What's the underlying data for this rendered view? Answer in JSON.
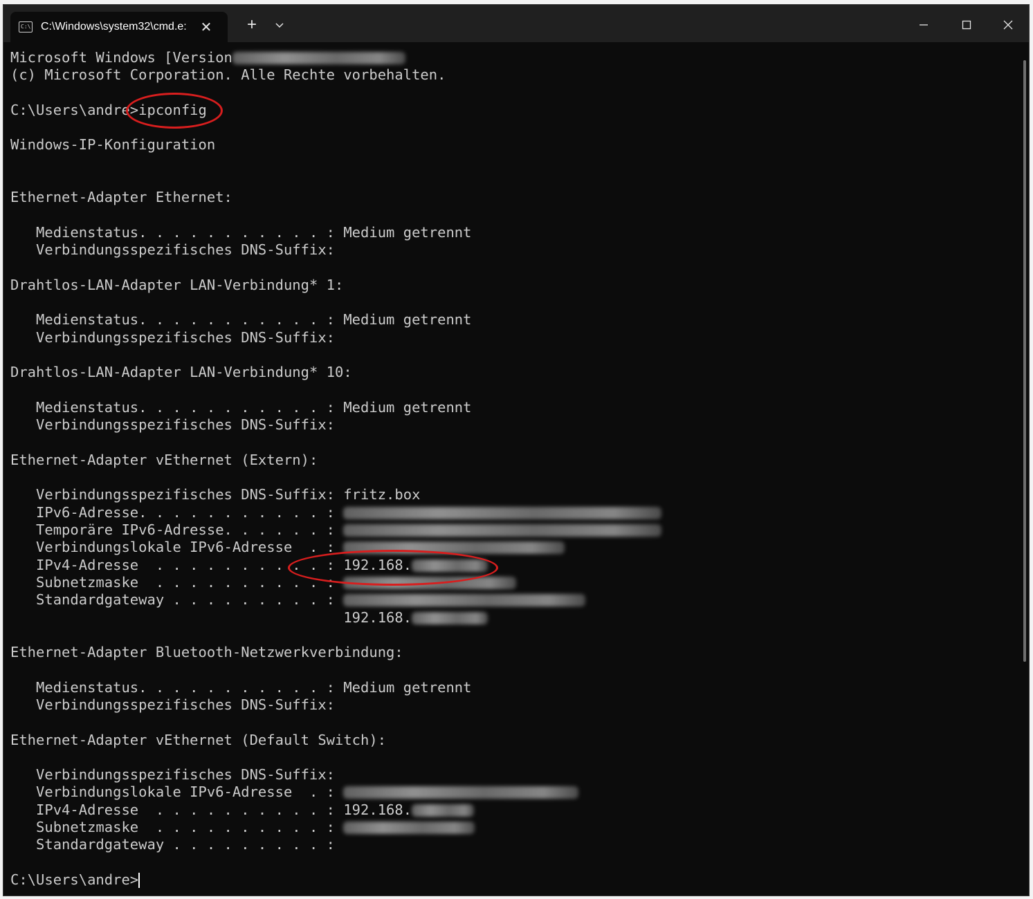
{
  "window": {
    "tab_title": "C:\\Windows\\system32\\cmd.e:",
    "tab_close_glyph": "✕",
    "new_tab_glyph": "+",
    "dropdown_glyph": "⌄",
    "min_glyph": "—",
    "max_glyph": "☐",
    "close_glyph": "✕"
  },
  "terminal": {
    "lines": [
      "Microsoft Windows [Version",
      "(c) Microsoft Corporation. Alle Rechte vorbehalten.",
      "",
      "C:\\Users\\andre>ipconfig",
      "",
      "Windows-IP-Konfiguration",
      "",
      "",
      "Ethernet-Adapter Ethernet:",
      "",
      "   Medienstatus. . . . . . . . . . . : Medium getrennt",
      "   Verbindungsspezifisches DNS-Suffix:",
      "",
      "Drahtlos-LAN-Adapter LAN-Verbindung* 1:",
      "",
      "   Medienstatus. . . . . . . . . . . : Medium getrennt",
      "   Verbindungsspezifisches DNS-Suffix:",
      "",
      "Drahtlos-LAN-Adapter LAN-Verbindung* 10:",
      "",
      "   Medienstatus. . . . . . . . . . . : Medium getrennt",
      "   Verbindungsspezifisches DNS-Suffix:",
      "",
      "Ethernet-Adapter vEthernet (Extern):",
      "",
      "   Verbindungsspezifisches DNS-Suffix: fritz.box",
      "   IPv6-Adresse. . . . . . . . . . . : ",
      "   Temporäre IPv6-Adresse. . . . . . : ",
      "   Verbindungslokale IPv6-Adresse  . : ",
      "   IPv4-Adresse  . . . . . . . . . . : 192.168.",
      "   Subnetzmaske  . . . . . . . . . . : ",
      "   Standardgateway . . . . . . . . . : ",
      "                                       192.168.",
      "",
      "Ethernet-Adapter Bluetooth-Netzwerkverbindung:",
      "",
      "   Medienstatus. . . . . . . . . . . : Medium getrennt",
      "   Verbindungsspezifisches DNS-Suffix:",
      "",
      "Ethernet-Adapter vEthernet (Default Switch):",
      "",
      "   Verbindungsspezifisches DNS-Suffix:",
      "   Verbindungslokale IPv6-Adresse  . : ",
      "   IPv4-Adresse  . . . . . . . . . . : 192.168.",
      "   Subnetzmaske  . . . . . . . . . . : ",
      "   Standardgateway . . . . . . . . . : ",
      "",
      "C:\\Users\\andre>"
    ]
  }
}
